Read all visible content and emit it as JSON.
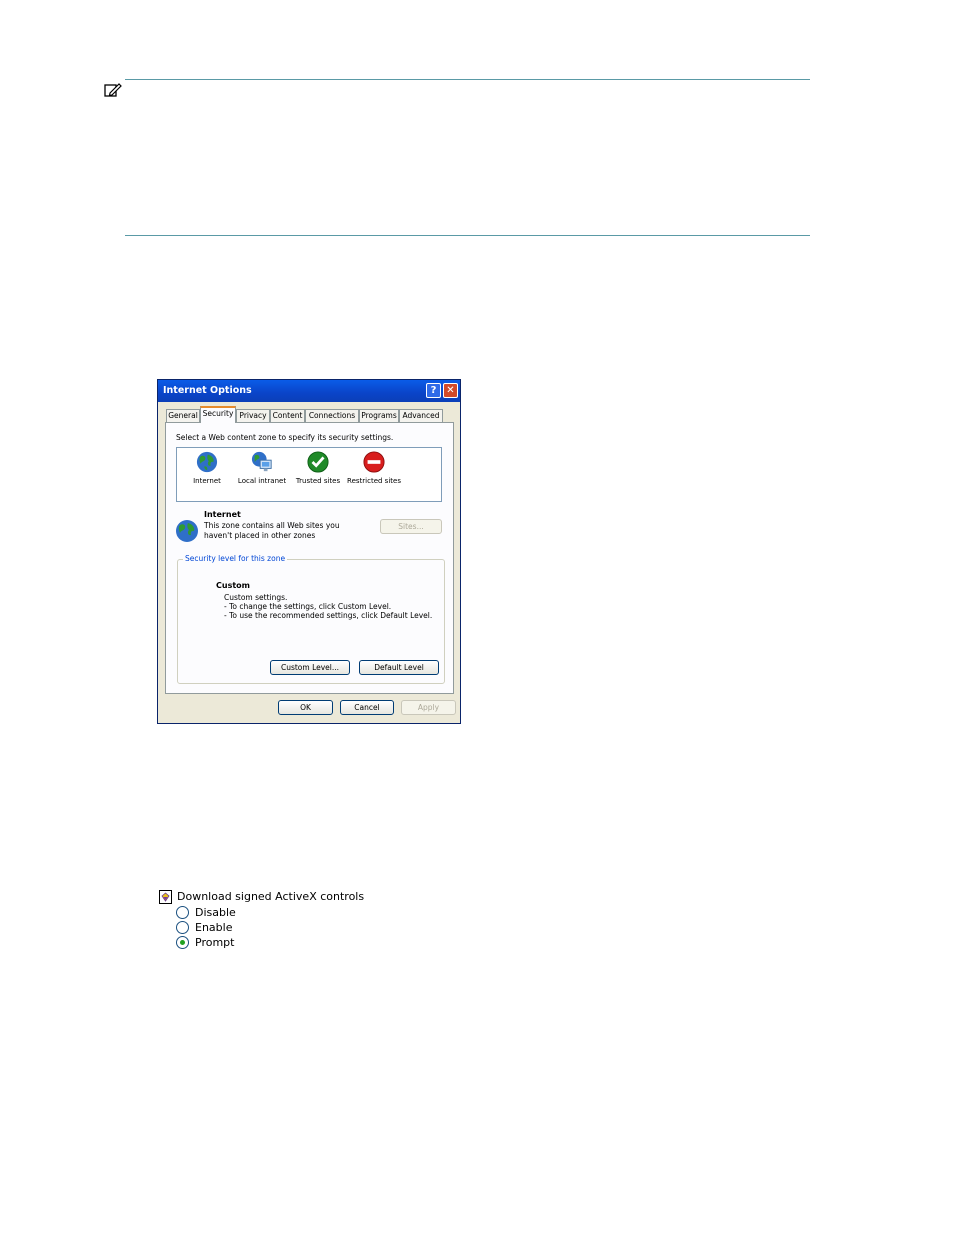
{
  "dialog": {
    "title": "Internet Options",
    "help_glyph": "?",
    "close_glyph": "✕",
    "tabs": [
      {
        "label": "General"
      },
      {
        "label": "Security"
      },
      {
        "label": "Privacy"
      },
      {
        "label": "Content"
      },
      {
        "label": "Connections"
      },
      {
        "label": "Programs"
      },
      {
        "label": "Advanced"
      }
    ],
    "active_tab": "Security",
    "zone_prompt": "Select a Web content zone to specify its security settings.",
    "zones": [
      {
        "label": "Internet",
        "icon": "globe-icon"
      },
      {
        "label": "Local intranet",
        "icon": "intranet-icon"
      },
      {
        "label": "Trusted sites",
        "icon": "checkmark-icon"
      },
      {
        "label": "Restricted sites",
        "icon": "restricted-icon"
      }
    ],
    "selected_zone": {
      "name": "Internet",
      "description": "This zone contains all Web sites you haven't placed in other zones"
    },
    "sites_button": "Sites...",
    "security_group_label": "Security level for this zone",
    "level": {
      "name": "Custom",
      "lines": [
        "Custom settings.",
        "- To change the settings, click Custom Level.",
        "- To use the recommended settings, click Default Level."
      ]
    },
    "custom_level_button": "Custom Level...",
    "default_level_button": "Default Level",
    "ok_button": "OK",
    "cancel_button": "Cancel",
    "apply_button": "Apply"
  },
  "activex": {
    "title": "Download signed ActiveX controls",
    "options": [
      {
        "label": "Disable",
        "selected": false
      },
      {
        "label": "Enable",
        "selected": false
      },
      {
        "label": "Prompt",
        "selected": true
      }
    ]
  },
  "colors": {
    "rule": "#5a9aa6",
    "titlebar": "#0a44c8",
    "dialog_bg": "#ece9d8",
    "accent_blue": "#0046d5",
    "radio_selected": "#21a121"
  }
}
